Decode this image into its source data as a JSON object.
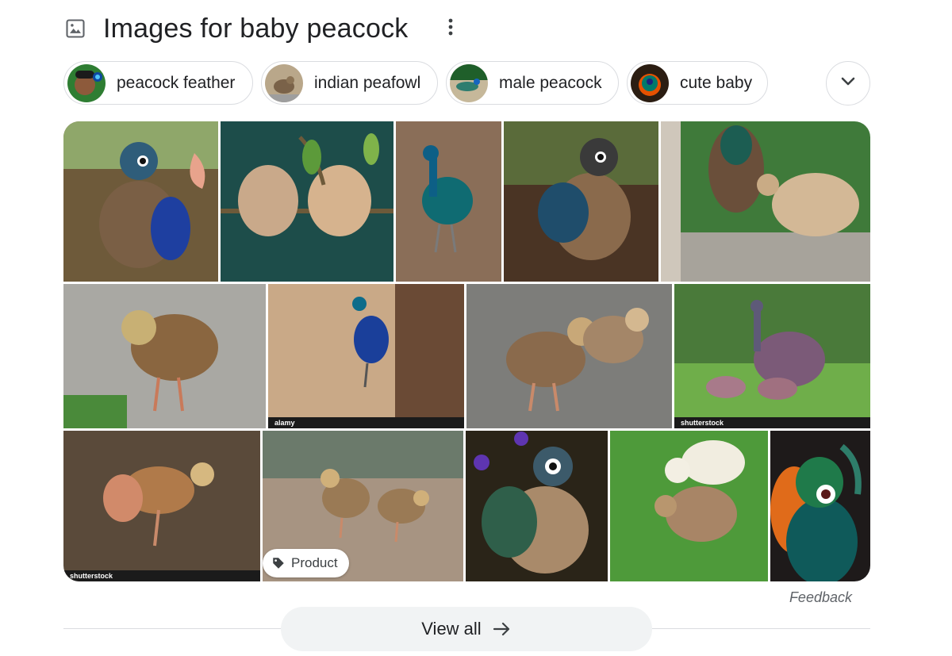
{
  "header": {
    "title": "Images for baby peacock",
    "image_icon": "image-icon",
    "more_icon": "more-vert-icon"
  },
  "chips": [
    {
      "label": "peacock feather"
    },
    {
      "label": "indian peafowl"
    },
    {
      "label": "male peacock"
    },
    {
      "label": "cute baby"
    }
  ],
  "expand_icon": "chevron-down-icon",
  "images": [
    {
      "alt": "baby peacock chick with blue feathers",
      "watermark": ""
    },
    {
      "alt": "two peacock chicks on branch",
      "watermark": ""
    },
    {
      "alt": "small peacock with blue neck",
      "watermark": ""
    },
    {
      "alt": "baby peacock with spotted feathers",
      "watermark": ""
    },
    {
      "alt": "peahen with chick",
      "watermark": ""
    },
    {
      "alt": "peacock chick on gravel",
      "watermark": ""
    },
    {
      "alt": "peacock by tree",
      "watermark": "alamy"
    },
    {
      "alt": "two peacock chicks on asphalt",
      "watermark": ""
    },
    {
      "alt": "peahen with chicks on grass",
      "watermark": "shutterstock"
    },
    {
      "alt": "peacock chick spreading wings",
      "watermark": "shutterstock"
    },
    {
      "alt": "two peacock chicks on ground",
      "watermark": ""
    },
    {
      "alt": "fluffy baby peacock",
      "watermark": ""
    },
    {
      "alt": "white and brown chicks on grass",
      "watermark": ""
    },
    {
      "alt": "colorful peacock portrait",
      "watermark": ""
    }
  ],
  "product_badge": {
    "label": "Product",
    "icon": "tag-icon"
  },
  "feedback": "Feedback",
  "view_all": {
    "label": "View all",
    "icon": "arrow-right-icon"
  },
  "colors": {
    "text": "#202124",
    "muted": "#5f6368",
    "border": "#dadce0",
    "button_bg": "#f1f3f4"
  }
}
